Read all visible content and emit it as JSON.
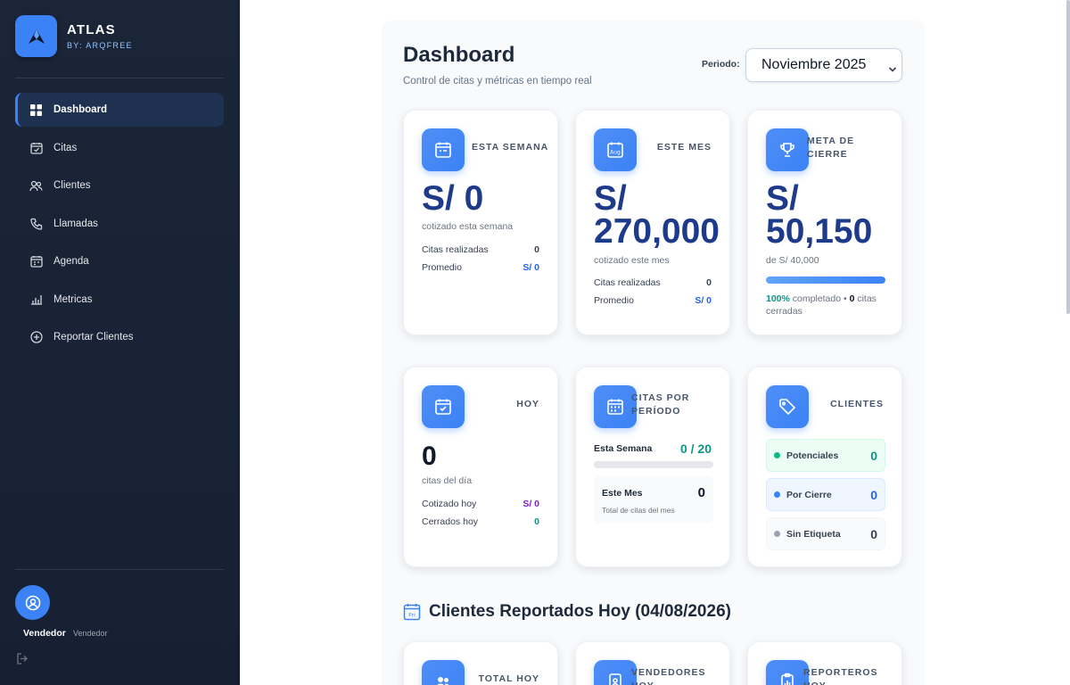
{
  "brand": {
    "title": "ATLAS",
    "subtitle": "BY: ARQFREE"
  },
  "sidebar": {
    "items": [
      {
        "label": "Dashboard",
        "icon": "grid-icon",
        "active": true
      },
      {
        "label": "Citas",
        "icon": "calendar-check-icon"
      },
      {
        "label": "Clientes",
        "icon": "users-icon"
      },
      {
        "label": "Llamadas",
        "icon": "phone-icon"
      },
      {
        "label": "Agenda",
        "icon": "calendar-icon"
      },
      {
        "label": "Metricas",
        "icon": "bar-chart-icon"
      },
      {
        "label": "Reportar Clientes",
        "icon": "plus-circle-icon"
      }
    ],
    "user": {
      "name": "Vendedor",
      "role": "Vendedor"
    }
  },
  "header": {
    "title": "Dashboard",
    "subtitle": "Control de citas y métricas en tiempo real",
    "period_label": "Periodo:",
    "period_value": "Noviembre 2025"
  },
  "cards": {
    "week": {
      "label": "ESTA SEMANA",
      "value": "S/ 0",
      "caption": "cotizado esta semana",
      "row1_label": "Citas realizadas",
      "row1_value": "0",
      "row2_label": "Promedio",
      "row2_value": "S/ 0"
    },
    "month": {
      "label": "ESTE MES",
      "value_line1": "S/",
      "value_line2": "270,000",
      "caption": "cotizado este mes",
      "row1_label": "Citas realizadas",
      "row1_value": "0",
      "row2_label": "Promedio",
      "row2_value": "S/ 0"
    },
    "goal": {
      "label": "META DE CIERRE",
      "value_line1": "S/",
      "value_line2": "50,150",
      "caption": "de S/ 40,000",
      "progress_percent": 100,
      "pct_text": "100%",
      "completed_text": " completado • ",
      "closed_count": "0",
      "closed_text": " citas cerradas"
    },
    "today": {
      "label": "HOY",
      "value": "0",
      "caption": "citas del día",
      "row1_label": "Cotizado hoy",
      "row1_value": "S/ 0",
      "row2_label": "Cerrados hoy",
      "row2_value": "0"
    },
    "period": {
      "label": "CITAS POR PERÍODO",
      "week_label": "Esta Semana",
      "week_value": "0 / 20",
      "week_progress": 0,
      "month_label": "Este Mes",
      "month_value": "0",
      "month_caption": "Total de citas del mes"
    },
    "clients": {
      "label": "CLIENTES",
      "items": [
        {
          "label": "Potenciales",
          "value": "0",
          "color": "#10b981"
        },
        {
          "label": "Por Cierre",
          "value": "0",
          "color": "#3b82f6"
        },
        {
          "label": "Sin Etiqueta",
          "value": "0",
          "color": "#9ca3af"
        }
      ]
    }
  },
  "section": {
    "title": "Clientes Reportados Hoy (04/08/2026)"
  },
  "bottom_cards": [
    {
      "label": "TOTAL HOY"
    },
    {
      "label": "VENDEDORES HOY"
    },
    {
      "label": "REPORTEROS HOY"
    }
  ],
  "colors": {
    "accent": "#3b82f6",
    "sidebar_bg": "#1b2538",
    "value_blue": "#1e3a8a"
  }
}
